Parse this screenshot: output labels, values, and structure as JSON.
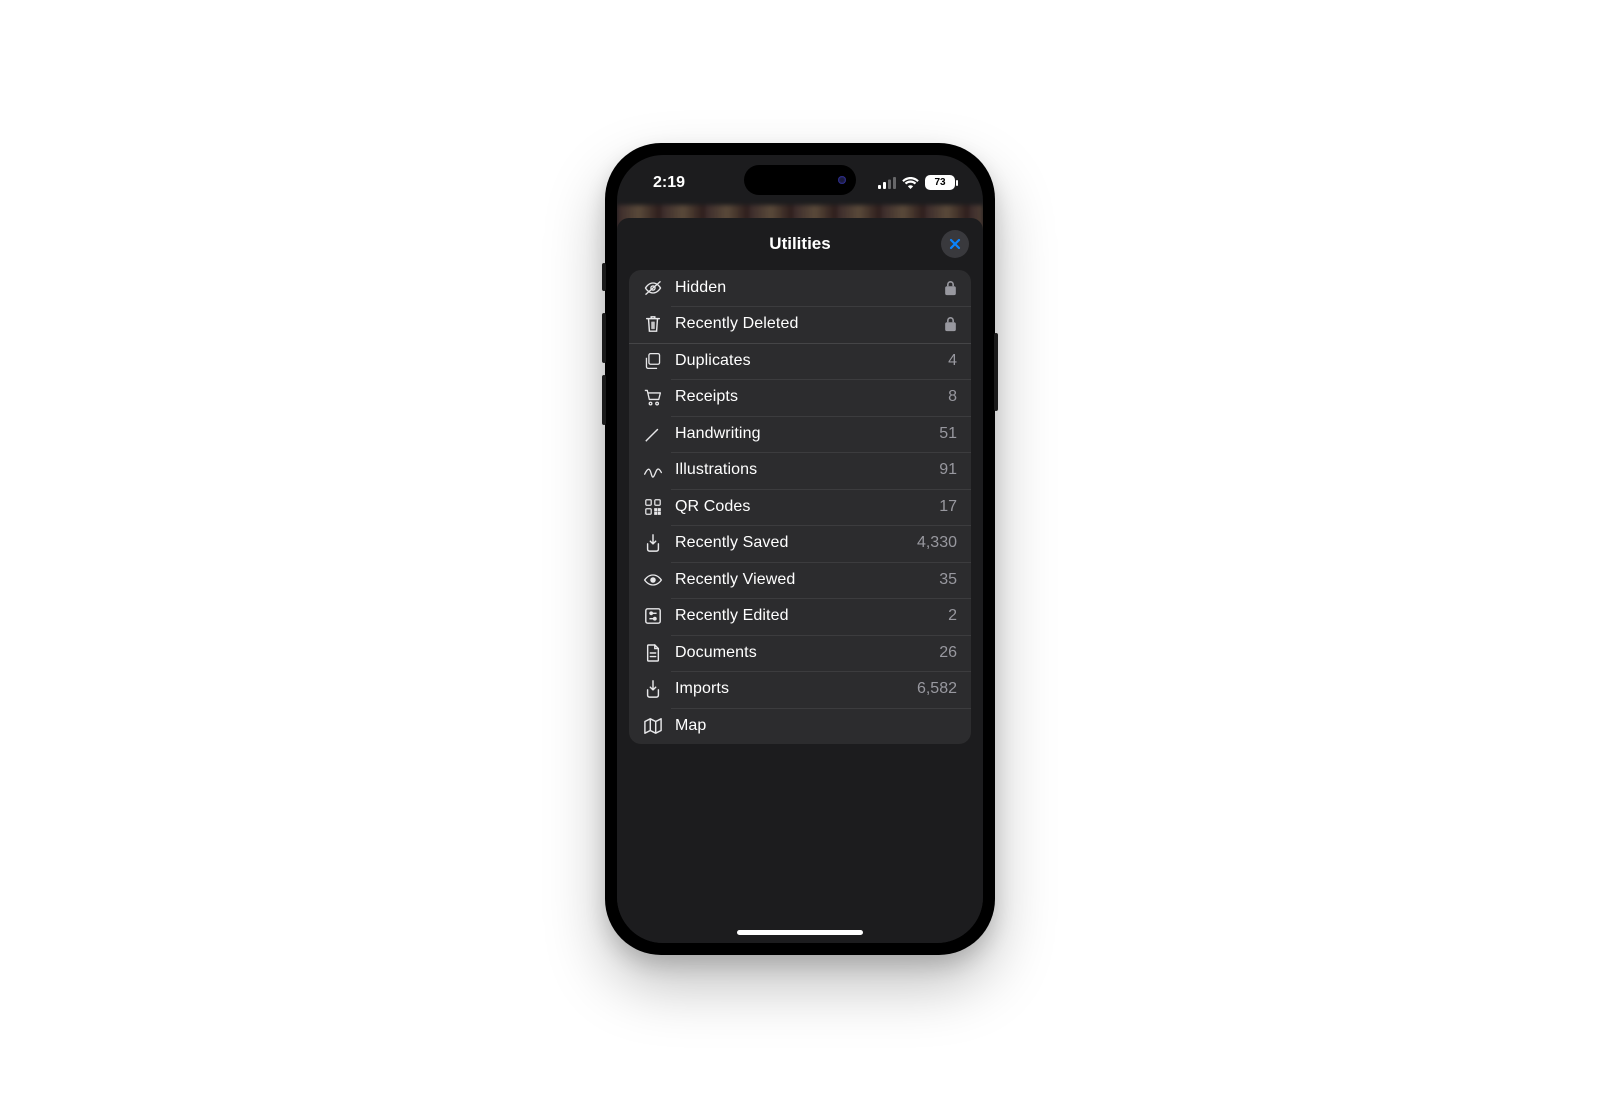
{
  "status": {
    "time": "2:19",
    "battery": "73"
  },
  "sheet": {
    "title": "Utilities"
  },
  "rows": {
    "hidden": {
      "label": "Hidden"
    },
    "recentlyDeleted": {
      "label": "Recently Deleted"
    },
    "duplicates": {
      "label": "Duplicates",
      "count": "4"
    },
    "receipts": {
      "label": "Receipts",
      "count": "8"
    },
    "handwriting": {
      "label": "Handwriting",
      "count": "51"
    },
    "illustrations": {
      "label": "Illustrations",
      "count": "91"
    },
    "qrcodes": {
      "label": "QR Codes",
      "count": "17"
    },
    "recentlySaved": {
      "label": "Recently Saved",
      "count": "4,330"
    },
    "recentlyViewed": {
      "label": "Recently Viewed",
      "count": "35"
    },
    "recentlyEdited": {
      "label": "Recently Edited",
      "count": "2"
    },
    "documents": {
      "label": "Documents",
      "count": "26"
    },
    "imports": {
      "label": "Imports",
      "count": "6,582"
    },
    "map": {
      "label": "Map"
    }
  }
}
